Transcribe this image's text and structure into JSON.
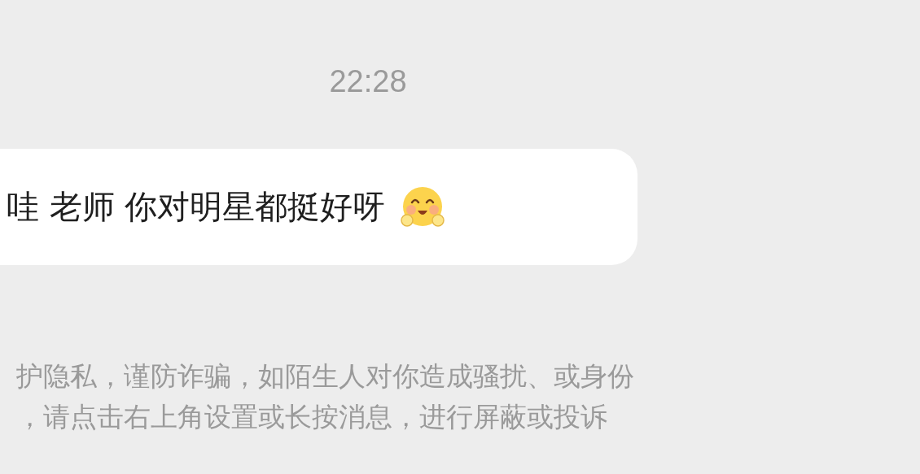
{
  "timestamp": "22:28",
  "message": {
    "text": "哇 老师 你对明星都挺好呀"
  },
  "notice": {
    "lines": [
      "护隐私，谨防诈骗，如陌生人对你造成骚扰、或身份",
      "，请点击右上角设置或长按消息，进行屏蔽或投诉"
    ]
  }
}
